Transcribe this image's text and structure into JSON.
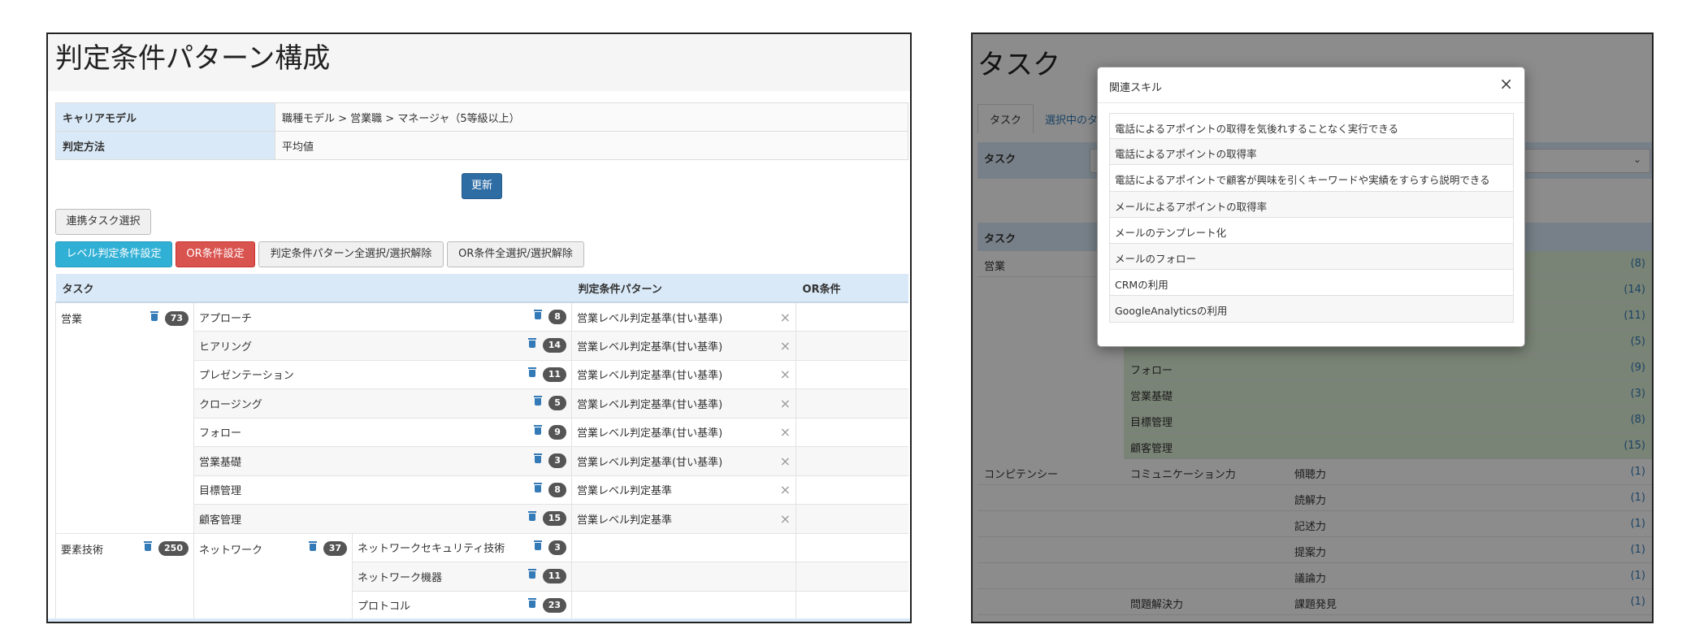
{
  "left": {
    "title": "判定条件パターン構成",
    "info": [
      {
        "label": "キャリアモデル",
        "value": "職種モデル > 営業職 > マネージャ（5等級以上）"
      },
      {
        "label": "判定方法",
        "value": "平均値"
      }
    ],
    "update_button": "更新",
    "linked_task_button": "連携タスク選択",
    "level_condition_button": "レベル判定条件設定",
    "or_condition_button": "OR条件設定",
    "pattern_toggle_button": "判定条件パターン全選択/選択解除",
    "or_toggle_button": "OR条件全選択/選択解除",
    "table": {
      "headers": {
        "task": "タスク",
        "pattern": "判定条件パターン",
        "or": "OR条件"
      },
      "sales": {
        "name": "営業",
        "count": "73"
      },
      "sales_rows": [
        {
          "name": "アプローチ",
          "count": "8",
          "pattern": "営業レベル判定基準(甘い基準)"
        },
        {
          "name": "ヒアリング",
          "count": "14",
          "pattern": "営業レベル判定基準(甘い基準)"
        },
        {
          "name": "プレゼンテーション",
          "count": "11",
          "pattern": "営業レベル判定基準(甘い基準)"
        },
        {
          "name": "クロージング",
          "count": "5",
          "pattern": "営業レベル判定基準(甘い基準)"
        },
        {
          "name": "フォロー",
          "count": "9",
          "pattern": "営業レベル判定基準(甘い基準)"
        },
        {
          "name": "営業基礎",
          "count": "3",
          "pattern": "営業レベル判定基準(甘い基準)"
        },
        {
          "name": "目標管理",
          "count": "8",
          "pattern": "営業レベル判定基準"
        },
        {
          "name": "顧客管理",
          "count": "15",
          "pattern": "営業レベル判定基準"
        }
      ],
      "tech": {
        "name": "要素技術",
        "count": "250"
      },
      "network": {
        "name": "ネットワーク",
        "count": "37"
      },
      "network_rows": [
        {
          "name": "ネットワークセキュリティ技術",
          "count": "3"
        },
        {
          "name": "ネットワーク機器",
          "count": "11"
        },
        {
          "name": "プロトコル",
          "count": "23"
        }
      ],
      "clear_icon": "×"
    }
  },
  "right": {
    "title": "タスク",
    "tabs": [
      "タスク",
      "選択中のタ"
    ],
    "head1_label": "タスク",
    "head2_label": "タスク",
    "select_chevron": "⌄",
    "sales_label": "営業",
    "rows": [
      {
        "c2": "",
        "c3": "",
        "count": "(8)"
      },
      {
        "c2": "",
        "c3": "",
        "count": "(14)"
      },
      {
        "c2": "",
        "c3": "",
        "count": "(11)"
      },
      {
        "c2": "",
        "c3": "",
        "count": "(5)"
      },
      {
        "c2": "フォロー",
        "c3": "",
        "count": "(9)"
      },
      {
        "c2": "営業基礎",
        "c3": "",
        "count": "(3)"
      },
      {
        "c2": "目標管理",
        "c3": "",
        "count": "(8)"
      },
      {
        "c2": "顧客管理",
        "c3": "",
        "count": "(15)"
      }
    ],
    "competency_label": "コンピテンシー",
    "communication_label": "コミュニケーション力",
    "problem_label": "問題解決力",
    "comp_rows": [
      {
        "c3": "傾聴力",
        "count": "(1)"
      },
      {
        "c3": "読解力",
        "count": "(1)"
      },
      {
        "c3": "記述力",
        "count": "(1)"
      },
      {
        "c3": "提案力",
        "count": "(1)"
      },
      {
        "c3": "議論力",
        "count": "(1)"
      },
      {
        "c3": "課題発見",
        "count": "(1)"
      }
    ]
  },
  "modal": {
    "title": "関連スキル",
    "close": "×",
    "skills": [
      "電話によるアポイントの取得を気後れすることなく実行できる",
      "電話によるアポイントの取得率",
      "電話によるアポイントで顧客が興味を引くキーワードや実績をすらすら説明できる",
      "メールによるアポイントの取得率",
      "メールのテンプレート化",
      "メールのフォロー",
      "CRMの利用",
      "GoogleAnalyticsの利用"
    ]
  }
}
